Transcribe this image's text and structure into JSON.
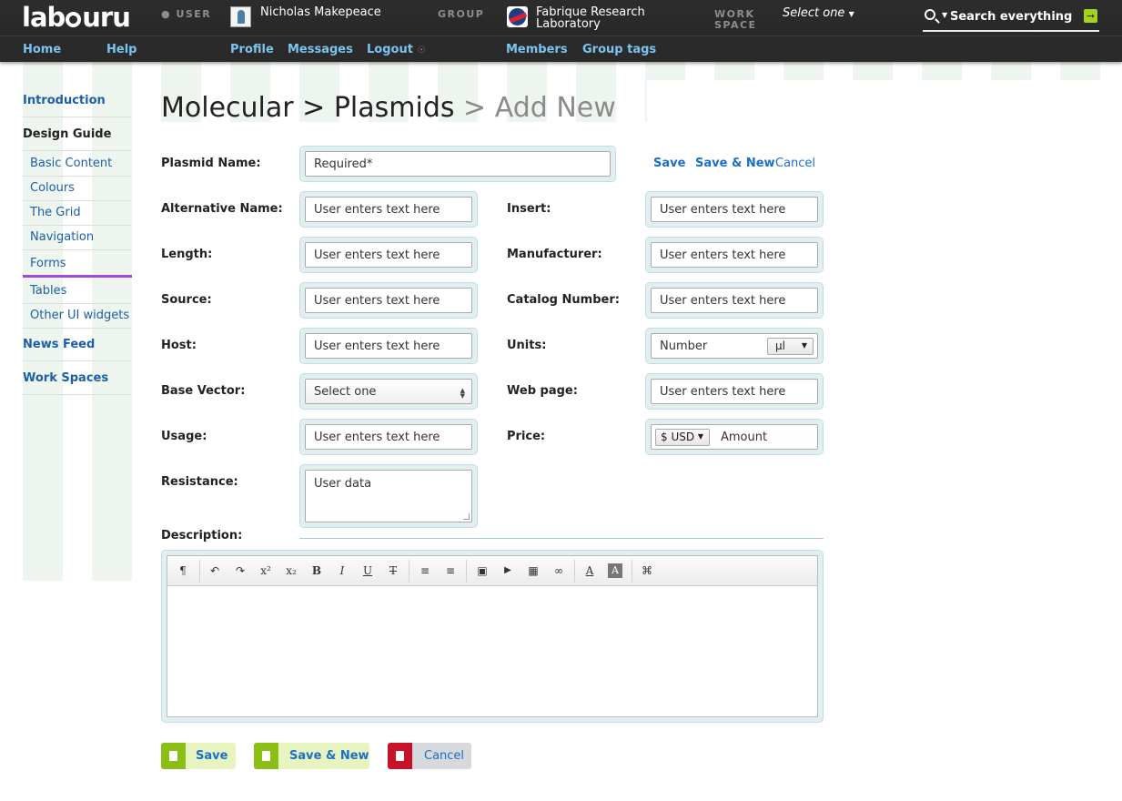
{
  "header": {
    "logo": "labguru",
    "user_caption": "USER",
    "user_name": "Nicholas Makepeace",
    "group_caption": "GROUP",
    "group_name_line1": "Fabrique Research",
    "group_name_line2": "Laboratory",
    "workspace_caption_1": "WORK",
    "workspace_caption_2": "SPACE",
    "workspace_select": "Select one",
    "search_label": "Search everything",
    "nav": {
      "home": "Home",
      "help": "Help",
      "profile": "Profile",
      "messages": "Messages",
      "logout": "Logout",
      "members": "Members",
      "group_tags": "Group tags"
    }
  },
  "sidebar": {
    "introduction": "Introduction",
    "design_guide": "Design Guide",
    "items": [
      "Basic Content",
      "Colours",
      "The Grid",
      "Navigation",
      "Forms",
      "Tables",
      "Other UI widgets"
    ],
    "active_item": "Forms",
    "news_feed": "News Feed",
    "work_spaces": "Work Spaces"
  },
  "page": {
    "breadcrumb_1": "Molecular",
    "sep": ">",
    "breadcrumb_2": "Plasmids",
    "breadcrumb_3": "Add New"
  },
  "form": {
    "plasmid_name": {
      "label": "Plasmid Name:",
      "value": "Required*"
    },
    "actions": {
      "save": "Save",
      "save_new": "Save & New",
      "cancel": "Cancel"
    },
    "left": [
      {
        "label": "Alternative Name:",
        "value": "User enters text here"
      },
      {
        "label": "Length:",
        "value": "User enters text here"
      },
      {
        "label": "Source:",
        "value": "User enters text here"
      },
      {
        "label": "Host:",
        "value": "User enters text here"
      },
      {
        "label": "Base Vector:",
        "value": "Select one"
      },
      {
        "label": "Usage:",
        "value": "User enters text here"
      },
      {
        "label": "Resistance:",
        "value": "User data"
      }
    ],
    "right": [
      {
        "label": "Insert:",
        "value": "User enters text here"
      },
      {
        "label": "Manufacturer:",
        "value": "User enters text here"
      },
      {
        "label": "Catalog Number:",
        "value": "User enters text here"
      },
      {
        "label": "Units:",
        "value": "Number",
        "unit": "µl"
      },
      {
        "label": "Web page:",
        "value": "User enters text here"
      },
      {
        "label": "Price:",
        "currency": "$ USD",
        "value": "Amount"
      }
    ],
    "description_label": "Description:"
  },
  "editor_toolbar": {
    "paragraph": "¶",
    "undo": "↶",
    "redo": "↷",
    "superscript": "x²",
    "subscript": "x₂",
    "bold": "B",
    "italic": "I",
    "underline": "U",
    "strike": "T",
    "bullet_list": "≡",
    "numbered_list": "≡",
    "image": "▣",
    "video": "▶",
    "table": "▦",
    "link": "∞",
    "text_color": "A",
    "bg_color": "A",
    "command": "⌘"
  },
  "bottom_buttons": {
    "save": "Save",
    "save_new": "Save & New",
    "cancel": "Cancel"
  },
  "colors": {
    "link": "#1b6fc8",
    "accent_purple": "#a448d6",
    "green_button": "#8cbf16",
    "red_button": "#c8122a",
    "field_frame": "#e1eff1"
  }
}
